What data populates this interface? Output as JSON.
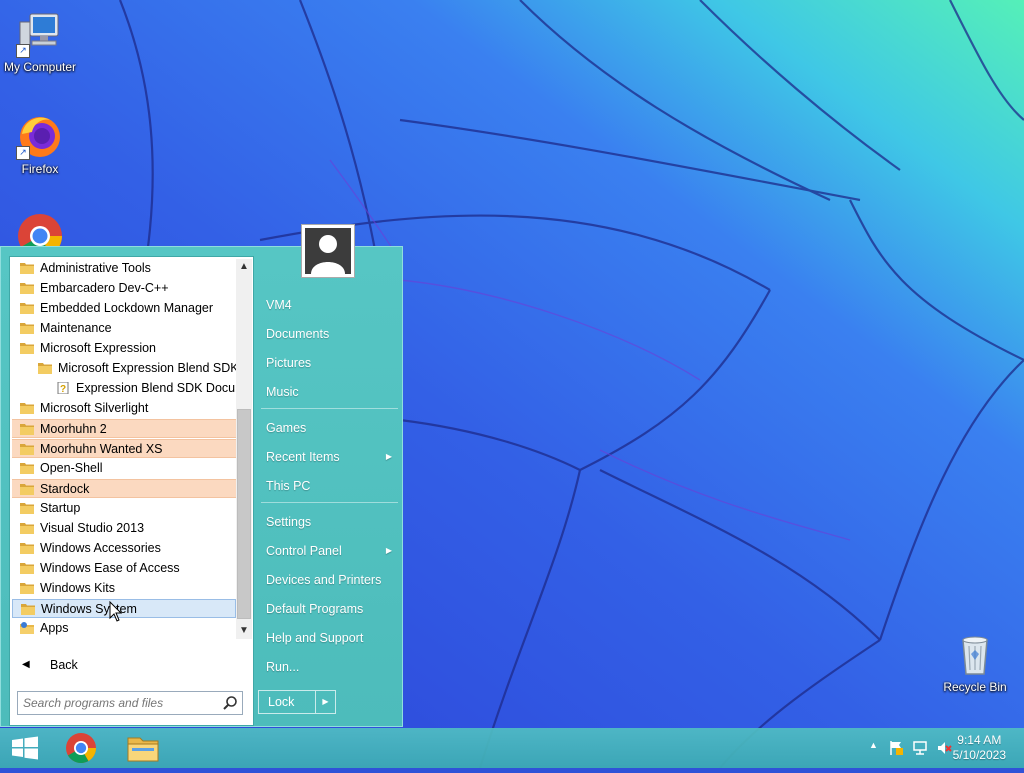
{
  "desktop": {
    "icons": [
      {
        "label": "My Computer",
        "icon": "computer-icon"
      },
      {
        "label": "Firefox",
        "icon": "firefox-icon"
      },
      {
        "label": "",
        "icon": "chrome-icon"
      },
      {
        "label": "Recycle Bin",
        "icon": "recycle-bin-icon"
      }
    ]
  },
  "start_menu": {
    "programs": [
      {
        "label": "Administrative Tools",
        "type": "folder",
        "state": "normal"
      },
      {
        "label": "Embarcadero Dev-C++",
        "type": "folder",
        "state": "normal"
      },
      {
        "label": "Embedded Lockdown Manager",
        "type": "folder",
        "state": "normal"
      },
      {
        "label": "Maintenance",
        "type": "folder",
        "state": "normal"
      },
      {
        "label": "Microsoft Expression",
        "type": "folder",
        "state": "normal"
      },
      {
        "label": "Microsoft Expression Blend SDK",
        "type": "folder",
        "state": "normal"
      },
      {
        "label": "Expression Blend SDK Docume",
        "type": "help-document",
        "state": "normal"
      },
      {
        "label": "Microsoft Silverlight",
        "type": "folder",
        "state": "normal"
      },
      {
        "label": "Moorhuhn 2",
        "type": "folder",
        "state": "highlighted"
      },
      {
        "label": "Moorhuhn Wanted XS",
        "type": "folder",
        "state": "highlighted"
      },
      {
        "label": "Open-Shell",
        "type": "folder",
        "state": "normal"
      },
      {
        "label": "Stardock",
        "type": "folder",
        "state": "highlighted"
      },
      {
        "label": "Startup",
        "type": "folder",
        "state": "normal"
      },
      {
        "label": "Visual Studio 2013",
        "type": "folder",
        "state": "normal"
      },
      {
        "label": "Windows Accessories",
        "type": "folder",
        "state": "normal"
      },
      {
        "label": "Windows Ease of Access",
        "type": "folder",
        "state": "normal"
      },
      {
        "label": "Windows Kits",
        "type": "folder",
        "state": "normal"
      },
      {
        "label": "Windows System",
        "type": "folder",
        "state": "selected"
      },
      {
        "label": "Apps",
        "type": "apps-folder",
        "state": "normal"
      }
    ],
    "back_label": "Back",
    "search_placeholder": "Search programs and files",
    "right_items": [
      {
        "label": "VM4",
        "submenu": false
      },
      {
        "label": "Documents",
        "submenu": false
      },
      {
        "label": "Pictures",
        "submenu": false
      },
      {
        "label": "Music",
        "submenu": false
      },
      {
        "label": "Games",
        "submenu": false
      },
      {
        "label": "Recent Items",
        "submenu": true
      },
      {
        "label": "This PC",
        "submenu": false
      },
      {
        "label": "Settings",
        "submenu": false
      },
      {
        "label": "Control Panel",
        "submenu": true
      },
      {
        "label": "Devices and Printers",
        "submenu": false
      },
      {
        "label": "Default Programs",
        "submenu": false
      },
      {
        "label": "Help and Support",
        "submenu": false
      },
      {
        "label": "Run...",
        "submenu": false
      }
    ],
    "lock_label": "Lock"
  },
  "taskbar": {
    "pinned": [
      "windows-start-icon",
      "chrome-icon",
      "file-explorer-icon"
    ],
    "tray_icons": [
      "show-hidden-icons-chevron",
      "action-center-flag-icon",
      "network-icon",
      "volume-muted-icon"
    ],
    "time": "9:14 AM",
    "date": "5/10/2023"
  },
  "colors": {
    "menu_bg": "#56c6c4",
    "highlight": "#fbd9c0",
    "selected": "#d8e8f8",
    "taskbar": "#4fb8bf"
  }
}
